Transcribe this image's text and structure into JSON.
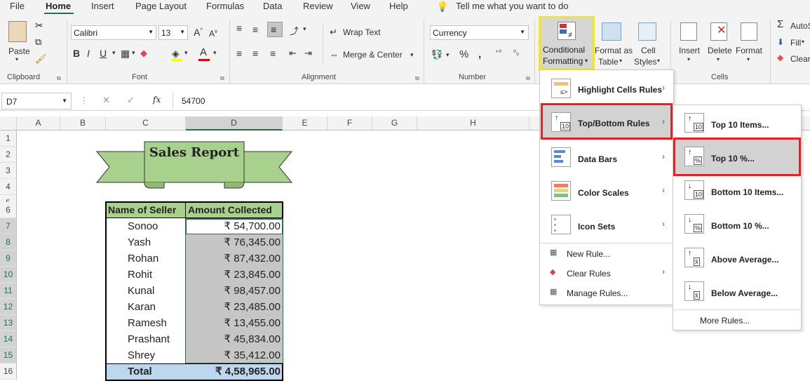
{
  "tabs": [
    "File",
    "Home",
    "Insert",
    "Page Layout",
    "Formulas",
    "Data",
    "Review",
    "View",
    "Help"
  ],
  "tell_me": "Tell me what you want to do",
  "ribbon": {
    "paste": "Paste",
    "clipboard": "Clipboard",
    "font_name": "Calibri",
    "font_size": "13",
    "font_label": "Font",
    "wrap_text": "Wrap Text",
    "merge_center": "Merge & Center",
    "alignment_label": "Alignment",
    "number_format": "Currency",
    "number_label": "Number",
    "cond_fmt_line1": "Conditional",
    "cond_fmt_line2": "Formatting",
    "format_as_line1": "Format as",
    "format_as_line2": "Table",
    "cell_styles_line1": "Cell",
    "cell_styles_line2": "Styles",
    "insert": "Insert",
    "delete": "Delete",
    "format": "Format",
    "cells_label": "Cells",
    "autosum": "AutoSum",
    "fill": "Fill",
    "clear": "Clear",
    "highlight_color": "#ffff00",
    "font_color_bar": "#e00000"
  },
  "formula_bar": {
    "name_box": "D7",
    "fx": "fx",
    "value": "54700"
  },
  "columns": [
    "A",
    "B",
    "C",
    "D",
    "E",
    "F",
    "G",
    "H"
  ],
  "rows": [
    "1",
    "2",
    "3",
    "4",
    "5",
    "6",
    "7",
    "8",
    "9",
    "10",
    "11",
    "12",
    "13",
    "14",
    "15",
    "16"
  ],
  "banner_title": "Sales Report",
  "table": {
    "header": [
      "Name of Seller",
      "Amount Collected"
    ],
    "rows": [
      [
        "Sonoo",
        "₹ 54,700.00"
      ],
      [
        "Yash",
        "₹ 76,345.00"
      ],
      [
        "Rohan",
        "₹ 87,432.00"
      ],
      [
        "Rohit",
        "₹ 23,845.00"
      ],
      [
        "Kunal",
        "₹ 98,457.00"
      ],
      [
        "Karan",
        "₹ 23,485.00"
      ],
      [
        "Ramesh",
        "₹ 13,455.00"
      ],
      [
        "Prashant",
        "₹ 45,834.00"
      ],
      [
        "Shrey",
        "₹ 35,412.00"
      ]
    ],
    "total_label": "Total",
    "total_value": "₹ 4,58,965.00",
    "header_color": "#a9d18e",
    "total_color": "#bdd7ee"
  },
  "cf_menu": {
    "highlight": "Highlight Cells Rules",
    "topbottom": "Top/Bottom Rules",
    "databars": "Data Bars",
    "colorscales": "Color Scales",
    "iconsets": "Icon Sets",
    "newrule": "New Rule...",
    "clearrules": "Clear Rules",
    "managerules": "Manage Rules..."
  },
  "sub_menu": {
    "top10items": "Top 10 Items...",
    "top10pct": "Top 10 %...",
    "bottom10items": "Bottom 10 Items...",
    "bottom10pct": "Bottom 10 %...",
    "above": "Above Average...",
    "below": "Below Average...",
    "more": "More Rules..."
  }
}
